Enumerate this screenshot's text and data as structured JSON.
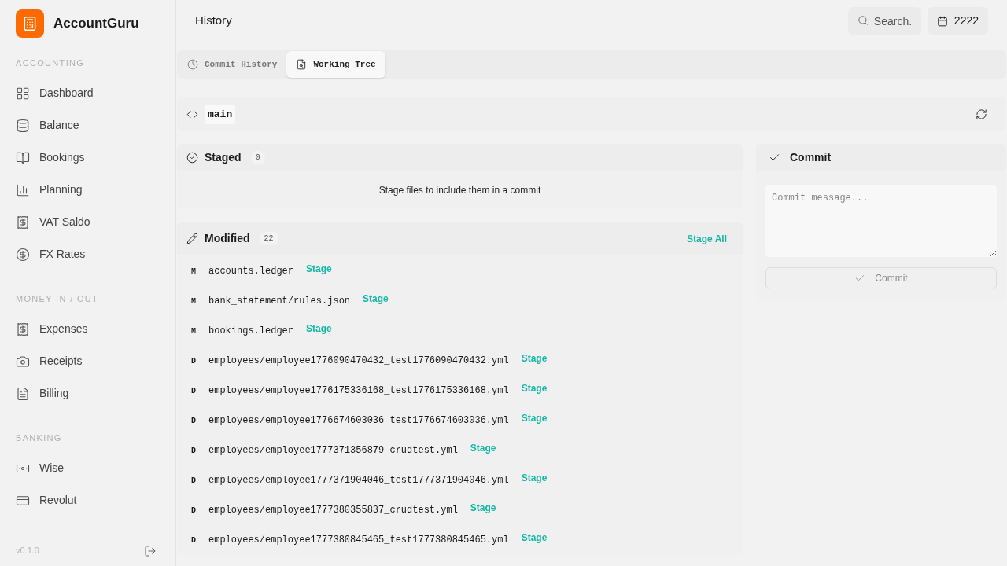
{
  "app": {
    "name": "AccountGuru"
  },
  "sidebar": {
    "sections": [
      {
        "title": "ACCOUNTING",
        "items": [
          {
            "label": "Dashboard"
          },
          {
            "label": "Balance"
          },
          {
            "label": "Bookings"
          },
          {
            "label": "Planning"
          },
          {
            "label": "VAT Saldo"
          },
          {
            "label": "FX Rates"
          }
        ]
      },
      {
        "title": "MONEY IN / OUT",
        "items": [
          {
            "label": "Expenses"
          },
          {
            "label": "Receipts"
          },
          {
            "label": "Billing"
          }
        ]
      },
      {
        "title": "BANKING",
        "items": [
          {
            "label": "Wise"
          },
          {
            "label": "Revolut"
          }
        ]
      }
    ],
    "version": "v0.1.0"
  },
  "header": {
    "title": "History",
    "search": {
      "placeholder": "Search."
    },
    "year": "2222"
  },
  "tabs": [
    {
      "label": "Commit History",
      "selected": false
    },
    {
      "label": "Working Tree",
      "selected": true
    }
  ],
  "branch": "main",
  "staged": {
    "title": "Staged",
    "count": "0",
    "empty_text": "Stage files to include them in a commit"
  },
  "modified": {
    "title": "Modified",
    "count": "22",
    "action": "Stage All",
    "files": [
      {
        "status": "M",
        "path": "accounts.ledger",
        "action": "Stage"
      },
      {
        "status": "M",
        "path": "bank_statement/rules.json",
        "action": "Stage"
      },
      {
        "status": "M",
        "path": "bookings.ledger",
        "action": "Stage"
      },
      {
        "status": "D",
        "path": "employees/employee1776090470432_test1776090470432.yml",
        "action": "Stage"
      },
      {
        "status": "D",
        "path": "employees/employee1776175336168_test1776175336168.yml",
        "action": "Stage"
      },
      {
        "status": "D",
        "path": "employees/employee1776674603036_test1776674603036.yml",
        "action": "Stage"
      },
      {
        "status": "D",
        "path": "employees/employee1777371356879_crudtest.yml",
        "action": "Stage"
      },
      {
        "status": "D",
        "path": "employees/employee1777371904046_test1777371904046.yml",
        "action": "Stage"
      },
      {
        "status": "D",
        "path": "employees/employee1777380355837_crudtest.yml",
        "action": "Stage"
      },
      {
        "status": "D",
        "path": "employees/employee1777380845465_test1777380845465.yml",
        "action": "Stage"
      }
    ]
  },
  "commit": {
    "title": "Commit",
    "placeholder": "Commit message...",
    "button": "Commit",
    "button_disabled": true
  }
}
